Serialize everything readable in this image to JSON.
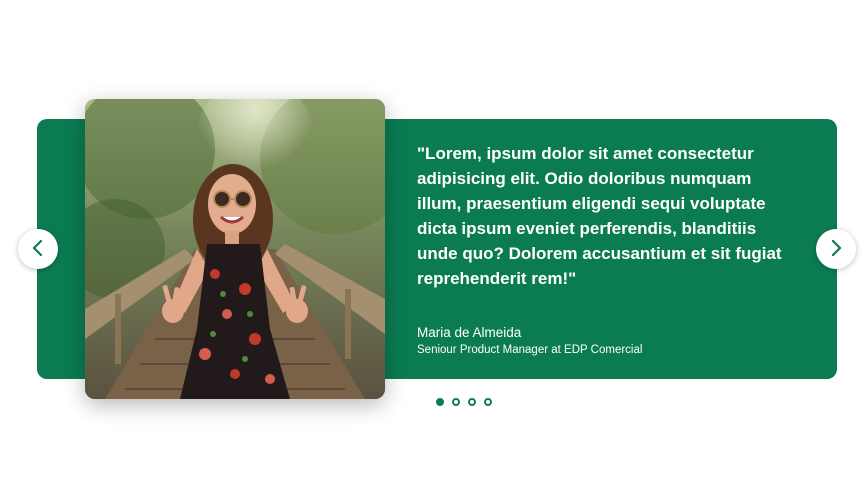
{
  "testimonial": {
    "quote": "\"Lorem, ipsum dolor sit amet consectetur adipisicing elit. Odio doloribus numquam illum, praesentium eligendi sequi voluptate dicta ipsum eveniet perferendis, blanditiis unde quo? Dolorem accusantium et sit fugiat reprehenderit rem!\"",
    "author_name": "Maria de Almeida",
    "author_role": "Seniour Product Manager at EDP Comercial"
  },
  "navigation": {
    "prev_icon": "chevron-left-icon",
    "next_icon": "chevron-right-icon"
  },
  "pagination": {
    "total": 4,
    "active_index": 0
  },
  "colors": {
    "accent": "#0b7c52",
    "background": "#ffffff",
    "text_on_accent": "#ffffff"
  }
}
